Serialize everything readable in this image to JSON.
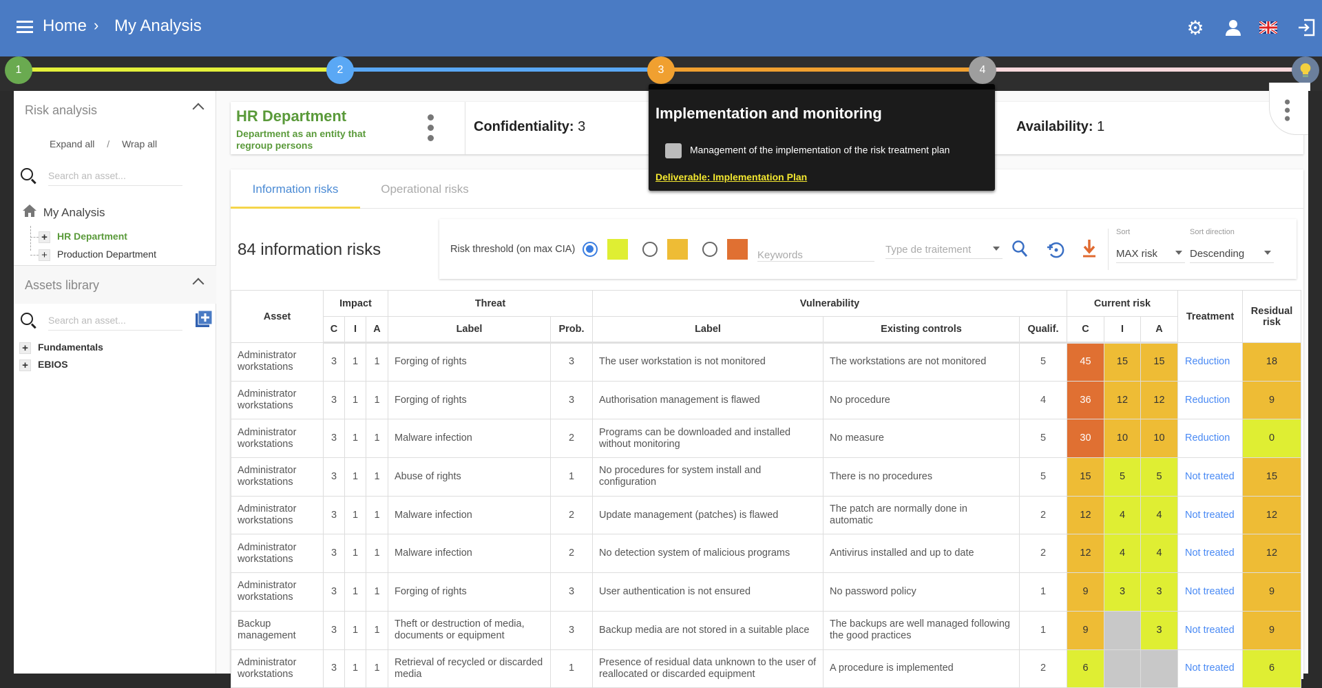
{
  "header": {
    "breadcrumb": [
      "Home",
      "My Analysis"
    ],
    "icons": [
      "menu-icon",
      "gear-icon",
      "user-icon",
      "uk-flag-icon",
      "logout-icon"
    ]
  },
  "stepper": {
    "steps": [
      {
        "label": "1",
        "color": "#6aaa50"
      },
      {
        "label": "2",
        "color": "#5aa8f5"
      },
      {
        "label": "3",
        "color": "#f0a030"
      },
      {
        "label": "4",
        "color": "#9e9e9e"
      }
    ],
    "lines": [
      "#e4f03a",
      "#5aa8f5",
      "#f0a030",
      "#f8d8dc"
    ]
  },
  "tooltip": {
    "title": "Implementation and monitoring",
    "item": "Management of the implementation of the risk treatment plan",
    "deliverable": "Deliverable: Implementation Plan"
  },
  "sidebar": {
    "risk_analysis": {
      "title": "Risk analysis",
      "expand_all": "Expand all",
      "separator": "/",
      "wrap_all": "Wrap all",
      "search_placeholder": "Search an asset...",
      "root": "My Analysis",
      "items": [
        "HR Department",
        "Production Department"
      ]
    },
    "assets_library": {
      "title": "Assets library",
      "search_placeholder": "Search an asset...",
      "items": [
        "Fundamentals",
        "EBIOS"
      ]
    }
  },
  "entity": {
    "name": "HR Department",
    "description": "Department as an entity that regroup persons",
    "confidentiality_label": "Confidentiality:",
    "confidentiality": "3",
    "availability_label": "Availability:",
    "availability": "1"
  },
  "tabs": [
    {
      "label": "Information risks",
      "active": true
    },
    {
      "label": "Operational risks",
      "active": false
    }
  ],
  "count_label": "84 information risks",
  "filters": {
    "threshold_label": "Risk threshold (on max CIA)",
    "threshold_options": [
      {
        "color": "#dfee33",
        "selected": true
      },
      {
        "color": "#eebc35",
        "selected": false
      },
      {
        "color": "#e07032",
        "selected": false
      }
    ],
    "keywords_placeholder": "Keywords",
    "treatment_placeholder": "Type de traitement",
    "sort_label": "Sort",
    "sort_value": "MAX risk",
    "direction_label": "Sort direction",
    "direction_value": "Descending"
  },
  "colors": {
    "high": "#e07032",
    "medium": "#eebc35",
    "low": "#dfee33",
    "none": "#c8c8c8",
    "link": "#4a8af4"
  },
  "table": {
    "groups": {
      "asset": "Asset",
      "impact": "Impact",
      "threat": "Threat",
      "vulnerability": "Vulnerability",
      "current": "Current risk",
      "treatment": "Treatment",
      "residual": "Residual risk"
    },
    "sub": {
      "c": "C",
      "i": "I",
      "a": "A",
      "label": "Label",
      "prob": "Prob.",
      "vlabel": "Label",
      "controls": "Existing controls",
      "qualif": "Qualif.",
      "rc": "C",
      "ri": "I",
      "ra": "A"
    },
    "rows": [
      {
        "asset": "Administrator workstations",
        "c": "3",
        "i": "1",
        "a": "1",
        "threat": "Forging of rights",
        "prob": "3",
        "vuln": "The user workstation is not monitored",
        "controls": "The workstations are not monitored",
        "qualif": "5",
        "rc": 45,
        "ri": 15,
        "ra": 15,
        "treatment": "Reduction",
        "residual": 18
      },
      {
        "asset": "Administrator workstations",
        "c": "3",
        "i": "1",
        "a": "1",
        "threat": "Forging of rights",
        "prob": "3",
        "vuln": "Authorisation management is flawed",
        "controls": "No procedure",
        "qualif": "4",
        "rc": 36,
        "ri": 12,
        "ra": 12,
        "treatment": "Reduction",
        "residual": 9
      },
      {
        "asset": "Administrator workstations",
        "c": "3",
        "i": "1",
        "a": "1",
        "threat": "Malware infection",
        "prob": "2",
        "vuln": "Programs can be downloaded and installed without monitoring",
        "controls": "No measure",
        "qualif": "5",
        "rc": 30,
        "ri": 10,
        "ra": 10,
        "treatment": "Reduction",
        "residual": 0
      },
      {
        "asset": "Administrator workstations",
        "c": "3",
        "i": "1",
        "a": "1",
        "threat": "Abuse of rights",
        "prob": "1",
        "vuln": "No procedures for system install and configuration",
        "controls": "There is no procedures",
        "qualif": "5",
        "rc": 15,
        "ri": 5,
        "ra": 5,
        "treatment": "Not treated",
        "residual": 15
      },
      {
        "asset": "Administrator workstations",
        "c": "3",
        "i": "1",
        "a": "1",
        "threat": "Malware infection",
        "prob": "2",
        "vuln": "Update management (patches) is flawed",
        "controls": "The patch are normally done in automatic",
        "qualif": "2",
        "rc": 12,
        "ri": 4,
        "ra": 4,
        "treatment": "Not treated",
        "residual": 12
      },
      {
        "asset": "Administrator workstations",
        "c": "3",
        "i": "1",
        "a": "1",
        "threat": "Malware infection",
        "prob": "2",
        "vuln": "No detection system of malicious programs",
        "controls": "Antivirus installed and up to date",
        "qualif": "2",
        "rc": 12,
        "ri": 4,
        "ra": 4,
        "treatment": "Not treated",
        "residual": 12
      },
      {
        "asset": "Administrator workstations",
        "c": "3",
        "i": "1",
        "a": "1",
        "threat": "Forging of rights",
        "prob": "3",
        "vuln": "User authentication is not ensured",
        "controls": "No password policy",
        "qualif": "1",
        "rc": 9,
        "ri": 3,
        "ra": 3,
        "treatment": "Not treated",
        "residual": 9
      },
      {
        "asset": "Backup management",
        "c": "3",
        "i": "1",
        "a": "1",
        "threat": "Theft or destruction of media, documents or equipment",
        "prob": "3",
        "vuln": "Backup media are not stored in a suitable place",
        "controls": "The backups are well managed following the good practices",
        "qualif": "1",
        "rc": 9,
        "ri": null,
        "ra": 3,
        "treatment": "Not treated",
        "residual": 9
      },
      {
        "asset": "Administrator workstations",
        "c": "3",
        "i": "1",
        "a": "1",
        "threat": "Retrieval of recycled or discarded media",
        "prob": "1",
        "vuln": "Presence of residual data unknown to the user of reallocated or discarded equipment",
        "controls": "A procedure is implemented",
        "qualif": "2",
        "rc": 6,
        "ri": null,
        "ra": null,
        "treatment": "Not treated",
        "residual": 6
      }
    ]
  }
}
